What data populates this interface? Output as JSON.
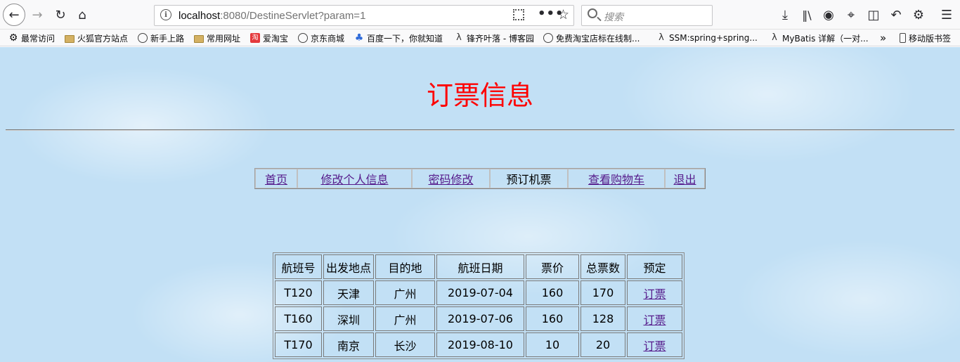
{
  "browser": {
    "url_host": "localhost",
    "url_rest": ":8080/DestineServlet?param=1",
    "search_placeholder": "搜索",
    "bookmarks": [
      {
        "label": "最常访问",
        "icon": "gear-icon"
      },
      {
        "label": "火狐官方站点",
        "icon": "folder-icon"
      },
      {
        "label": "新手上路",
        "icon": "globe-icon"
      },
      {
        "label": "常用网址",
        "icon": "folder-icon"
      },
      {
        "label": "爱淘宝",
        "icon": "taobao-icon"
      },
      {
        "label": "京东商城",
        "icon": "globe-icon"
      },
      {
        "label": "百度一下，你就知道",
        "icon": "paw-icon"
      },
      {
        "label": "锋齐叶落 - 博客园",
        "icon": "leaf-icon"
      },
      {
        "label": "免费淘宝店标在线制...",
        "icon": "globe-icon"
      },
      {
        "label": "SSM:spring+spring...",
        "icon": "leaf-icon"
      },
      {
        "label": "MyBatis 详解（一对...",
        "icon": "leaf-icon"
      }
    ],
    "bookmarks_overflow": "»",
    "mobile_bookmarks": "移动版书签"
  },
  "page": {
    "title": "订票信息",
    "nav": [
      "首页",
      "修改个人信息",
      "密码修改",
      "预订机票",
      "查看购物车",
      "退出"
    ],
    "table": {
      "headers": [
        "航班号",
        "出发地点",
        "目的地",
        "航班日期",
        "票价",
        "总票数",
        "预定"
      ],
      "rows": [
        [
          "T120",
          "天津",
          "广州",
          "2019-07-04",
          "160",
          "170",
          "订票"
        ],
        [
          "T160",
          "深圳",
          "广州",
          "2019-07-06",
          "160",
          "128",
          "订票"
        ],
        [
          "T170",
          "南京",
          "长沙",
          "2019-08-10",
          "10",
          "20",
          "订票"
        ]
      ]
    }
  }
}
